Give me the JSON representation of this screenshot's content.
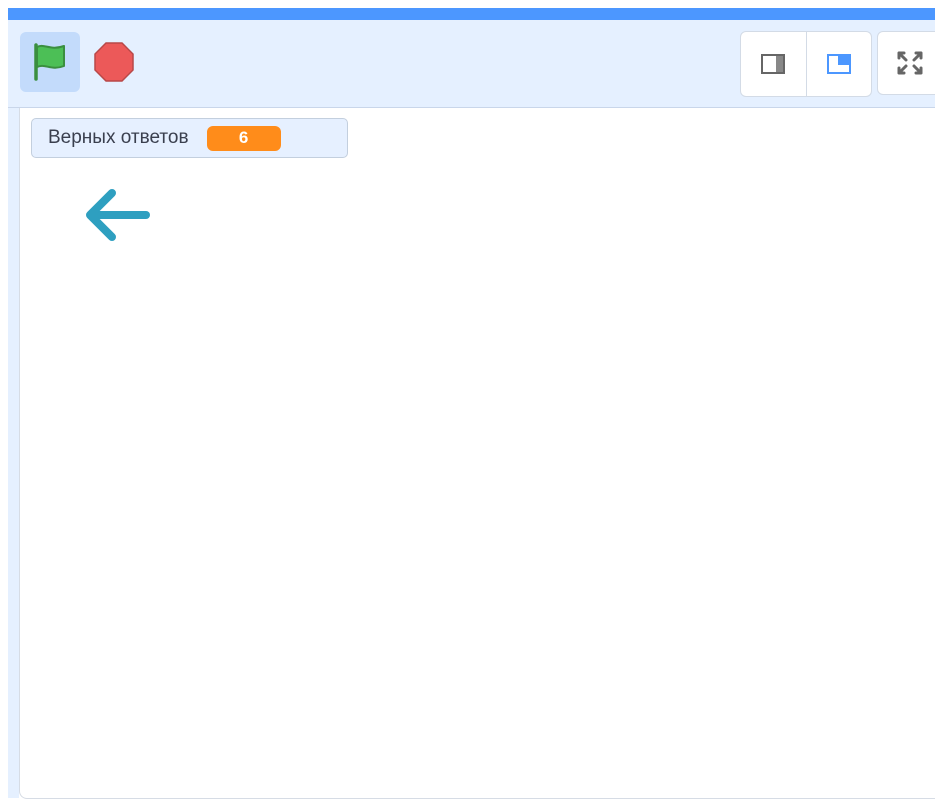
{
  "toolbar": {
    "green_flag_icon": "green-flag-icon",
    "stop_icon": "stop-sign-icon",
    "small_stage_icon": "small-stage-icon",
    "normal_stage_icon": "normal-stage-icon",
    "fullscreen_icon": "fullscreen-icon"
  },
  "stage": {
    "monitor": {
      "label": "Верных ответов",
      "value": "6"
    },
    "sprite": "left-arrow-sprite"
  },
  "colors": {
    "accent_blue": "#4c97ff",
    "control_bar": "#e5f0ff",
    "flag_green": "#4cbf56",
    "stop_red": "#ec5959",
    "monitor_orange": "#ff8c1a",
    "arrow_teal": "#2e9fc0"
  }
}
